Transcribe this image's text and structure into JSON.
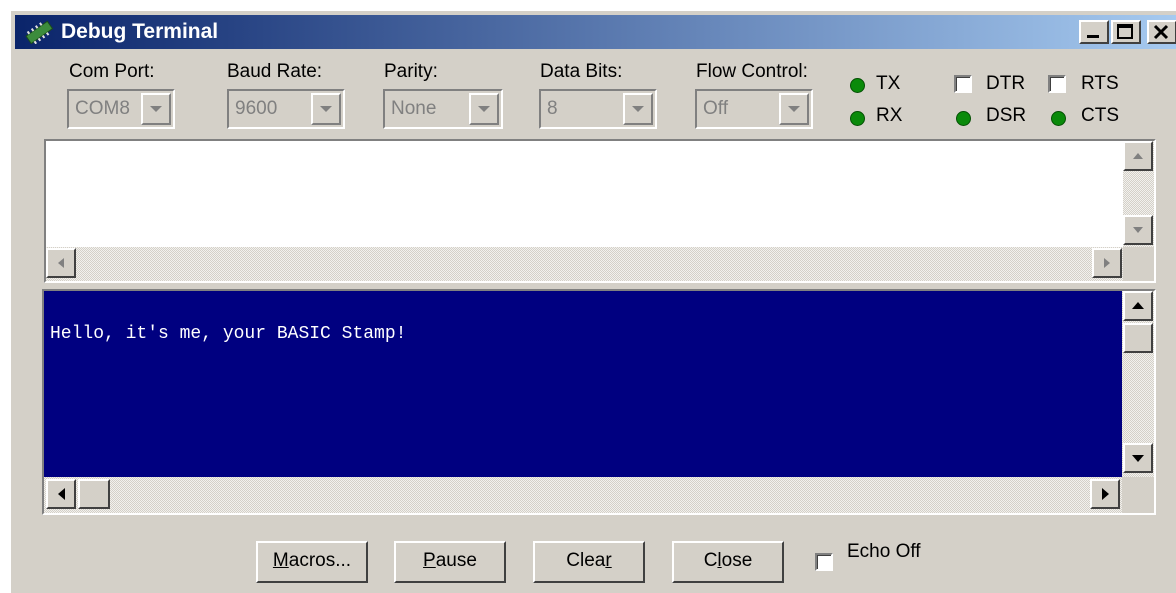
{
  "window": {
    "title": "Debug Terminal"
  },
  "settings": {
    "com_port": {
      "label": "Com Port:",
      "value": "COM8"
    },
    "baud_rate": {
      "label": "Baud Rate:",
      "value": "9600"
    },
    "parity": {
      "label": "Parity:",
      "value": "None"
    },
    "data_bits": {
      "label": "Data Bits:",
      "value": "8"
    },
    "flow_control": {
      "label": "Flow Control:",
      "value": "Off"
    }
  },
  "signals": {
    "tx": "TX",
    "rx": "RX",
    "dtr": "DTR",
    "rts": "RTS",
    "dsr": "DSR",
    "cts": "CTS",
    "led_color": "#0a8a0a"
  },
  "receive": {
    "text": "Hello, it's me, your BASIC Stamp!",
    "background": "#000080",
    "text_color": "#ffffff"
  },
  "buttons": {
    "macros": {
      "pre": "",
      "key": "M",
      "post": "acros..."
    },
    "pause": {
      "pre": "",
      "key": "P",
      "post": "ause"
    },
    "clear": {
      "pre": "Clea",
      "key": "r",
      "post": ""
    },
    "close": {
      "pre": "C",
      "key": "l",
      "post": "ose"
    }
  },
  "echo_off": {
    "label": "Echo Off"
  },
  "colors": {
    "face": "#d4d0c8",
    "title_start": "#0a246a",
    "title_end": "#a6caf0"
  }
}
